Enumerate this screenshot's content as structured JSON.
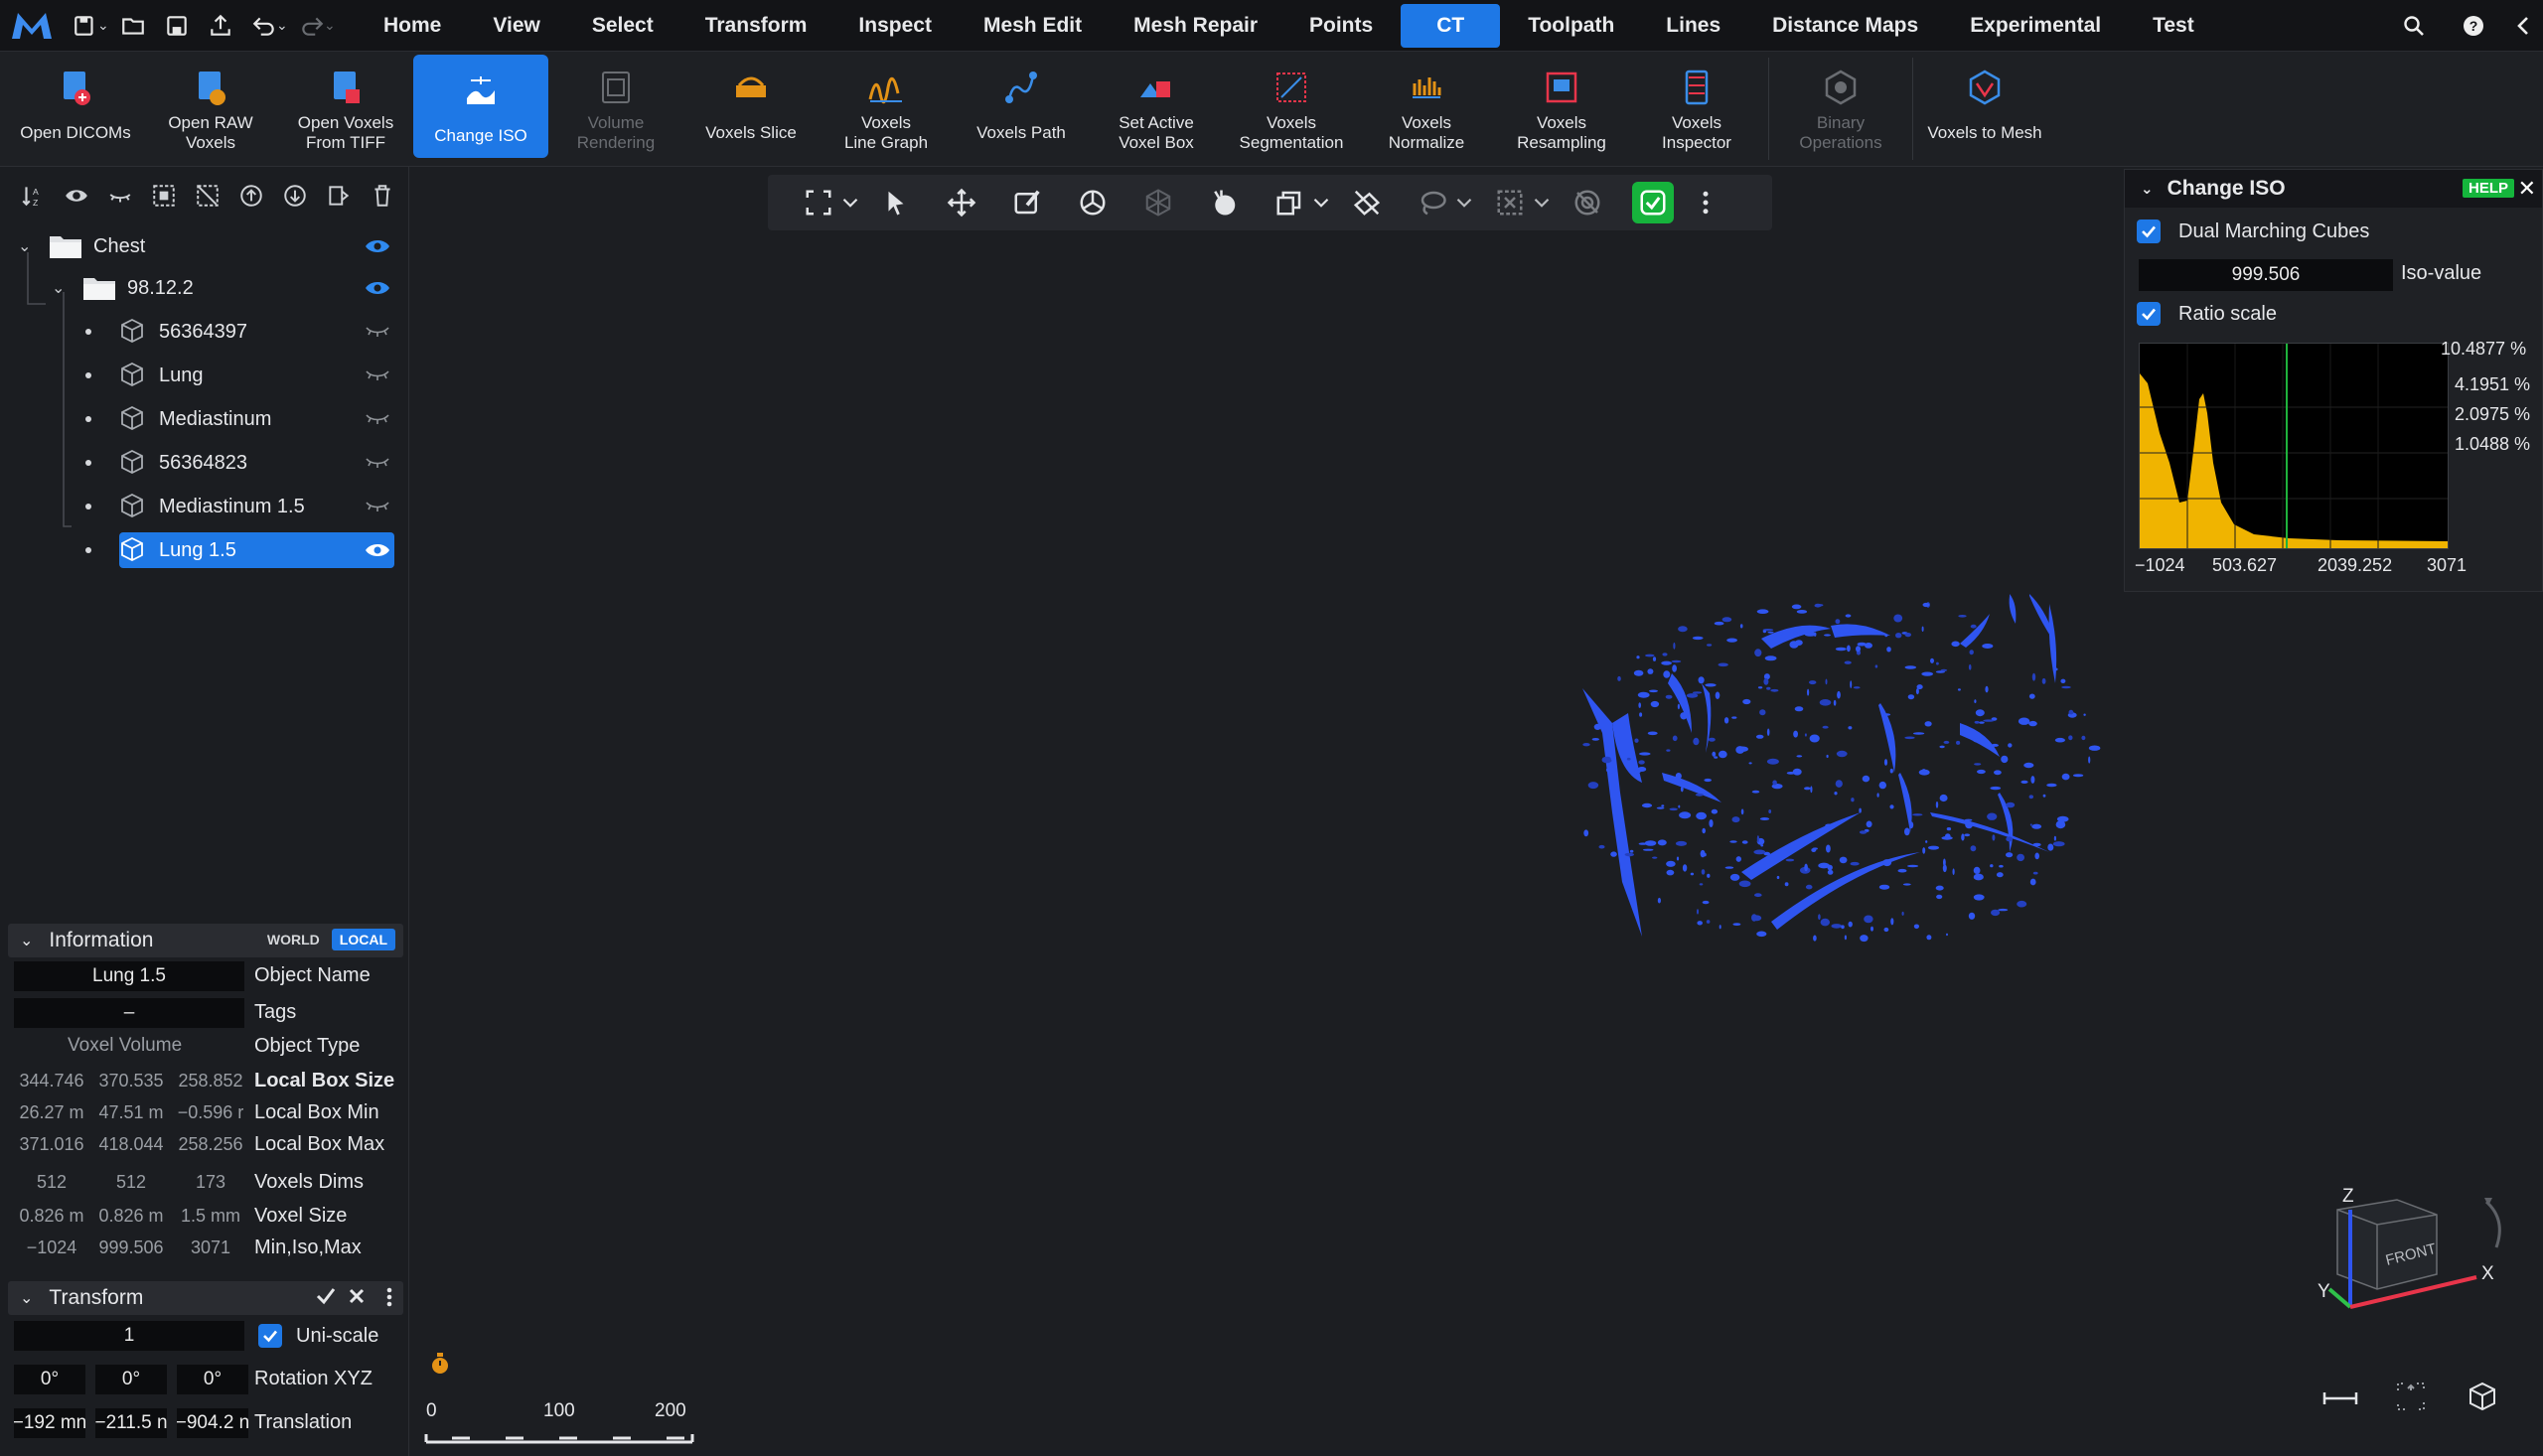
{
  "menubar": {
    "items": [
      {
        "label": "Home"
      },
      {
        "label": "View"
      },
      {
        "label": "Select"
      },
      {
        "label": "Transform"
      },
      {
        "label": "Inspect"
      },
      {
        "label": "Mesh Edit"
      },
      {
        "label": "Mesh Repair"
      },
      {
        "label": "Points"
      },
      {
        "label": "CT",
        "active": true
      },
      {
        "label": "Toolpath"
      },
      {
        "label": "Lines"
      },
      {
        "label": "Distance Maps"
      },
      {
        "label": "Experimental"
      },
      {
        "label": "Test"
      }
    ]
  },
  "ribbon": {
    "buttons": [
      {
        "label": "Open DICOMs",
        "icon": "open-dicoms-icon"
      },
      {
        "label": "Open RAW\nVoxels",
        "icon": "open-raw-voxels-icon"
      },
      {
        "label": "Open Voxels\nFrom TIFF",
        "icon": "open-voxels-tiff-icon"
      },
      {
        "label": "Change ISO",
        "icon": "change-iso-icon",
        "active": true
      },
      {
        "label": "Volume\nRendering",
        "icon": "volume-rendering-icon",
        "disabled": true
      },
      {
        "label": "Voxels Slice",
        "icon": "voxels-slice-icon"
      },
      {
        "label": "Voxels\nLine Graph",
        "icon": "voxels-line-graph-icon"
      },
      {
        "label": "Voxels Path",
        "icon": "voxels-path-icon"
      },
      {
        "label": "Set Active\nVoxel Box",
        "icon": "set-active-voxel-box-icon"
      },
      {
        "label": "Voxels\nSegmentation",
        "icon": "voxels-segmentation-icon"
      },
      {
        "label": "Voxels\nNormalize",
        "icon": "voxels-normalize-icon"
      },
      {
        "label": "Voxels\nResampling",
        "icon": "voxels-resampling-icon"
      },
      {
        "label": "Voxels\nInspector",
        "icon": "voxels-inspector-icon"
      },
      {
        "label": "Binary\nOperations",
        "icon": "binary-operations-icon",
        "disabled": true
      },
      {
        "label": "Voxels to Mesh",
        "icon": "voxels-to-mesh-icon"
      }
    ]
  },
  "scene": {
    "root": "Chest",
    "group": "98.12.2",
    "items": [
      {
        "label": "56364397",
        "visible": false
      },
      {
        "label": "Lung",
        "visible": false
      },
      {
        "label": "Mediastinum",
        "visible": false
      },
      {
        "label": "56364823",
        "visible": false
      },
      {
        "label": "Mediastinum 1.5",
        "visible": false
      },
      {
        "label": "Lung 1.5",
        "visible": true,
        "selected": true
      }
    ]
  },
  "information": {
    "title": "Information",
    "world": "WORLD",
    "local": "LOCAL",
    "object_name": "Lung 1.5",
    "object_name_label": "Object Name",
    "tags": "–",
    "tags_label": "Tags",
    "object_type": "Voxel Volume",
    "object_type_label": "Object Type",
    "rows": [
      {
        "label": "Local Box Size",
        "values": [
          "344.746",
          "370.535",
          "258.852"
        ],
        "bold": true
      },
      {
        "label": "Local Box Min",
        "values": [
          "26.27 m",
          "47.51 m",
          "−0.596 r"
        ],
        "bold": false
      },
      {
        "label": "Local Box Max",
        "values": [
          "371.016",
          "418.044",
          "258.256"
        ],
        "bold": false
      },
      {
        "label": "Voxels Dims",
        "values": [
          "512",
          "512",
          "173"
        ],
        "bold": false
      },
      {
        "label": "Voxel Size",
        "values": [
          "0.826 m",
          "0.826 m",
          "1.5 mm"
        ],
        "bold": false
      },
      {
        "label": "Min,Iso,Max",
        "values": [
          "−1024",
          "999.506",
          "3071"
        ],
        "bold": false
      }
    ]
  },
  "transform": {
    "title": "Transform",
    "scale": "1",
    "uniscale_label": "Uni-scale",
    "rotation": [
      "0°",
      "0°",
      "0°"
    ],
    "rotation_label": "Rotation XYZ",
    "translation": [
      "−192 mn",
      "−211.5 n",
      "−904.2 n"
    ],
    "translation_label": "Translation"
  },
  "iso_panel": {
    "title": "Change ISO",
    "help": "HELP",
    "dual_mc_label": "Dual Marching Cubes",
    "iso_value": "999.506",
    "iso_label": "Iso-value",
    "ratio_label": "Ratio scale",
    "y_ticks": [
      "10.4877 %",
      "4.1951 %",
      "2.0975 %",
      "1.0488 %"
    ],
    "x_ticks": [
      "−1024",
      "503.627",
      "2039.252",
      "3071"
    ],
    "colors": {
      "fill": "#f0b400",
      "marker": "#1fb23c"
    }
  },
  "scalebar": {
    "labels": [
      "0",
      "100",
      "200"
    ]
  },
  "gizmo": {
    "face_label": "FRONT",
    "axes": [
      "Z",
      "Y",
      "X"
    ]
  },
  "colors": {
    "accent": "#1e78e6",
    "mesh": "#2f55f0",
    "ok_green": "#16b33c"
  }
}
